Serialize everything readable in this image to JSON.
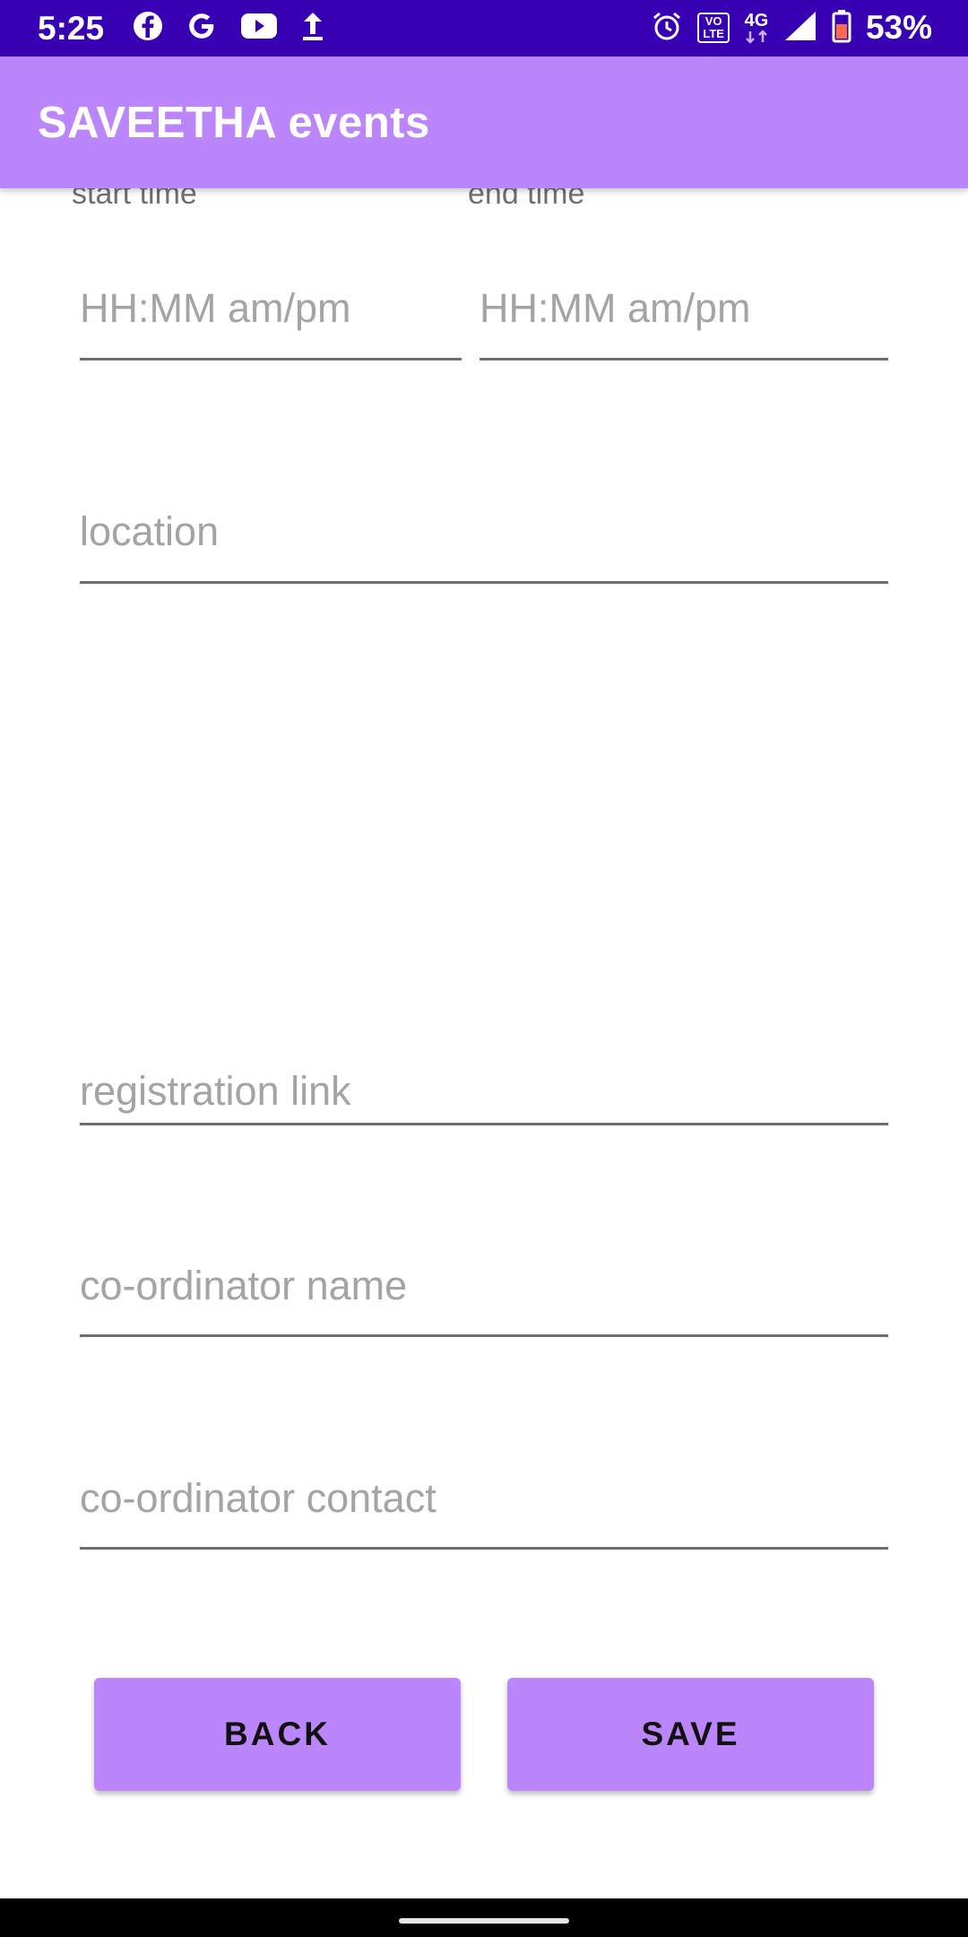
{
  "status_bar": {
    "time": "5:25",
    "battery_percent": "53%",
    "network": "4G",
    "volte": "VoLTE",
    "left_icons": [
      "facebook-icon",
      "google-icon",
      "youtube-icon",
      "upload-icon"
    ],
    "right_icons": [
      "alarm-icon",
      "volte-icon",
      "network-4g-icon",
      "signal-icon",
      "battery-icon"
    ],
    "color": "#3700b3"
  },
  "app_bar": {
    "title": "SAVEETHA events",
    "color": "#bb86fc"
  },
  "form": {
    "start_time_label": "start time",
    "end_time_label": "end time",
    "start_time": {
      "value": "",
      "placeholder": "HH:MM am/pm"
    },
    "end_time": {
      "value": "",
      "placeholder": "HH:MM am/pm"
    },
    "location": {
      "value": "",
      "placeholder": "location"
    },
    "registration_link": {
      "value": "",
      "placeholder": "registration link"
    },
    "coordinator_name": {
      "value": "",
      "placeholder": "co-ordinator name"
    },
    "coordinator_contact": {
      "value": "",
      "placeholder": "co-ordinator contact"
    }
  },
  "buttons": {
    "back_label": "BACK",
    "save_label": "SAVE",
    "color": "#bb86fc"
  }
}
